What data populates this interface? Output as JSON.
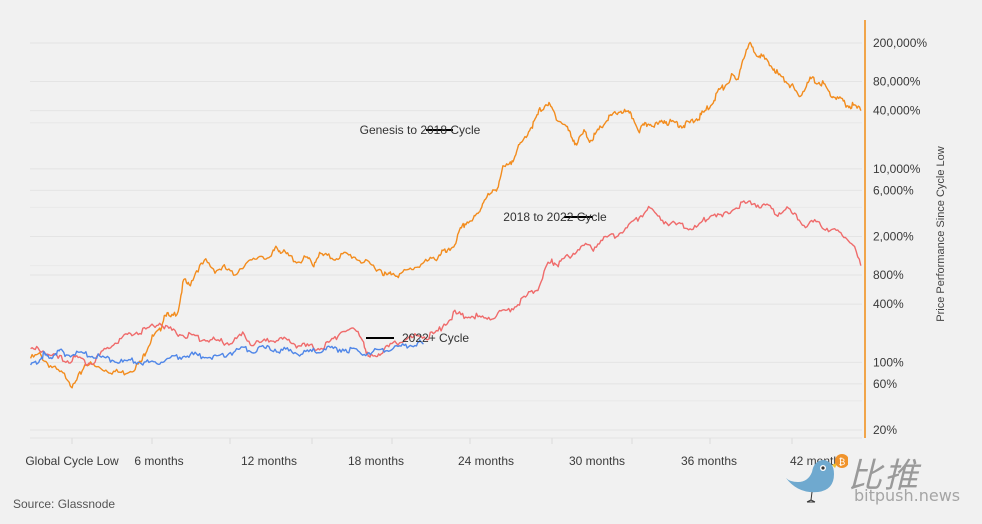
{
  "chart_data": {
    "type": "line",
    "title": "",
    "xlabel": "",
    "ylabel": "Price Performance Since Cycle Low",
    "y_scale": "log",
    "ylim": [
      15,
      300000
    ],
    "xlim_months": [
      -1,
      44
    ],
    "grid": true,
    "x_ticks": [
      {
        "m": -1.2,
        "label": "Global Cycle Low"
      },
      {
        "m": 6,
        "label": "6 months"
      },
      {
        "m": 12,
        "label": "12 months"
      },
      {
        "m": 18,
        "label": "18 months"
      },
      {
        "m": 24,
        "label": "24 months"
      },
      {
        "m": 30,
        "label": "30 months"
      },
      {
        "m": 36,
        "label": "36 months"
      },
      {
        "m": 42,
        "label": "42 months"
      }
    ],
    "y_ticks": [
      {
        "v": 200000,
        "label": "200,000%"
      },
      {
        "v": 80000,
        "label": "80,000%"
      },
      {
        "v": 40000,
        "label": "40,000%"
      },
      {
        "v": 10000,
        "label": "10,000%"
      },
      {
        "v": 6000,
        "label": "6,000%"
      },
      {
        "v": 2000,
        "label": "2,000%"
      },
      {
        "v": 800,
        "label": "800%"
      },
      {
        "v": 400,
        "label": "400%"
      },
      {
        "v": 100,
        "label": "100%"
      },
      {
        "v": 60,
        "label": "60%"
      },
      {
        "v": 20,
        "label": "20%"
      }
    ],
    "series": [
      {
        "name": "Genesis to 2018 Cycle",
        "color": "#f28c1e",
        "points": [
          [
            -1,
            110
          ],
          [
            -0.5,
            120
          ],
          [
            0,
            95
          ],
          [
            0.5,
            80
          ],
          [
            1,
            70
          ],
          [
            1.3,
            55
          ],
          [
            1.6,
            70
          ],
          [
            2,
            100
          ],
          [
            2.5,
            90
          ],
          [
            3,
            85
          ],
          [
            3.5,
            80
          ],
          [
            4,
            78
          ],
          [
            4.5,
            85
          ],
          [
            5,
            100
          ],
          [
            5.3,
            140
          ],
          [
            5.6,
            180
          ],
          [
            6,
            210
          ],
          [
            6.3,
            330
          ],
          [
            6.6,
            280
          ],
          [
            7,
            350
          ],
          [
            7.3,
            700
          ],
          [
            7.6,
            620
          ],
          [
            8,
            900
          ],
          [
            8.5,
            1100
          ],
          [
            9,
            900
          ],
          [
            9.5,
            950
          ],
          [
            10,
            800
          ],
          [
            10.5,
            1000
          ],
          [
            11,
            1100
          ],
          [
            11.5,
            1300
          ],
          [
            12,
            1150
          ],
          [
            12.3,
            1600
          ],
          [
            12.6,
            1400
          ],
          [
            13,
            1250
          ],
          [
            13.5,
            1100
          ],
          [
            14,
            1200
          ],
          [
            14.3,
            1000
          ],
          [
            14.6,
            1300
          ],
          [
            15,
            1250
          ],
          [
            15.5,
            1200
          ],
          [
            16,
            1300
          ],
          [
            16.5,
            1250
          ],
          [
            17,
            1100
          ],
          [
            17.5,
            1000
          ],
          [
            18,
            900
          ],
          [
            18.3,
            780
          ],
          [
            18.6,
            850
          ],
          [
            19,
            800
          ],
          [
            19.5,
            900
          ],
          [
            20,
            1000
          ],
          [
            20.5,
            1100
          ],
          [
            21,
            1200
          ],
          [
            21.3,
            1400
          ],
          [
            21.6,
            1350
          ],
          [
            22,
            1700
          ],
          [
            22.3,
            2300
          ],
          [
            22.6,
            2800
          ],
          [
            23,
            3000
          ],
          [
            23.3,
            3500
          ],
          [
            23.6,
            5000
          ],
          [
            24,
            5500
          ],
          [
            24.3,
            6500
          ],
          [
            24.6,
            10000
          ],
          [
            25,
            11000
          ],
          [
            25.3,
            15000
          ],
          [
            25.6,
            18000
          ],
          [
            26,
            25000
          ],
          [
            26.3,
            30000
          ],
          [
            26.6,
            40000
          ],
          [
            27,
            48000
          ],
          [
            27.3,
            40000
          ],
          [
            27.6,
            32000
          ],
          [
            28,
            28000
          ],
          [
            28.3,
            22000
          ],
          [
            28.6,
            18000
          ],
          [
            29,
            24000
          ],
          [
            29.3,
            20000
          ],
          [
            29.6,
            22000
          ],
          [
            30,
            28000
          ],
          [
            30.3,
            33000
          ],
          [
            30.6,
            36000
          ],
          [
            31,
            40000
          ],
          [
            31.3,
            38000
          ],
          [
            31.6,
            35000
          ],
          [
            32,
            25000
          ],
          [
            32.3,
            28000
          ],
          [
            32.6,
            30000
          ],
          [
            33,
            28000
          ],
          [
            33.3,
            32000
          ],
          [
            33.6,
            30000
          ],
          [
            34,
            30000
          ],
          [
            34.3,
            28000
          ],
          [
            34.6,
            29000
          ],
          [
            35,
            32000
          ],
          [
            35.3,
            35000
          ],
          [
            35.6,
            40000
          ],
          [
            36,
            50000
          ],
          [
            36.3,
            65000
          ],
          [
            36.6,
            70000
          ],
          [
            37,
            90000
          ],
          [
            37.3,
            80000
          ],
          [
            37.6,
            140000
          ],
          [
            38,
            190000
          ],
          [
            38.3,
            160000
          ],
          [
            38.6,
            150000
          ],
          [
            39,
            120000
          ],
          [
            39.3,
            110000
          ],
          [
            39.6,
            90000
          ],
          [
            40,
            80000
          ],
          [
            40.3,
            70000
          ],
          [
            40.6,
            55000
          ],
          [
            41,
            70000
          ],
          [
            41.3,
            85000
          ],
          [
            41.6,
            80000
          ],
          [
            42,
            75000
          ],
          [
            42.3,
            60000
          ],
          [
            42.6,
            55000
          ],
          [
            43,
            50000
          ],
          [
            43.3,
            45000
          ],
          [
            43.6,
            45000
          ],
          [
            44,
            40000
          ]
        ]
      },
      {
        "name": "2018 to 2022 Cycle",
        "color": "#ef6b6b",
        "points": [
          [
            -1,
            130
          ],
          [
            -0.5,
            140
          ],
          [
            0,
            120
          ],
          [
            0.5,
            110
          ],
          [
            1,
            105
          ],
          [
            1.5,
            110
          ],
          [
            2,
            100
          ],
          [
            2.5,
            105
          ],
          [
            3,
            130
          ],
          [
            3.5,
            160
          ],
          [
            4,
            180
          ],
          [
            4.5,
            200
          ],
          [
            5,
            210
          ],
          [
            5.5,
            230
          ],
          [
            6,
            260
          ],
          [
            6.5,
            220
          ],
          [
            7,
            200
          ],
          [
            7.5,
            190
          ],
          [
            8,
            180
          ],
          [
            8.5,
            175
          ],
          [
            9,
            170
          ],
          [
            9.5,
            160
          ],
          [
            10,
            165
          ],
          [
            10.5,
            190
          ],
          [
            11,
            155
          ],
          [
            11.5,
            160
          ],
          [
            12,
            170
          ],
          [
            12.5,
            175
          ],
          [
            13,
            165
          ],
          [
            13.5,
            150
          ],
          [
            14,
            145
          ],
          [
            14.5,
            140
          ],
          [
            15,
            150
          ],
          [
            15.5,
            180
          ],
          [
            16,
            220
          ],
          [
            16.5,
            210
          ],
          [
            17,
            180
          ],
          [
            17.3,
            110
          ],
          [
            17.6,
            115
          ],
          [
            18,
            130
          ],
          [
            18.5,
            145
          ],
          [
            19,
            165
          ],
          [
            19.5,
            175
          ],
          [
            20,
            190
          ],
          [
            20.5,
            185
          ],
          [
            21,
            200
          ],
          [
            21.5,
            260
          ],
          [
            22,
            320
          ],
          [
            22.5,
            300
          ],
          [
            23,
            310
          ],
          [
            23.5,
            280
          ],
          [
            24,
            300
          ],
          [
            24.5,
            330
          ],
          [
            25,
            350
          ],
          [
            25.5,
            420
          ],
          [
            26,
            500
          ],
          [
            26.5,
            600
          ],
          [
            27,
            1000
          ],
          [
            27.3,
            1100
          ],
          [
            27.6,
            1000
          ],
          [
            28,
            1200
          ],
          [
            28.5,
            1400
          ],
          [
            29,
            1600
          ],
          [
            29.5,
            1500
          ],
          [
            30,
            1900
          ],
          [
            30.5,
            2000
          ],
          [
            31,
            2200
          ],
          [
            31.5,
            2600
          ],
          [
            32,
            3200
          ],
          [
            32.5,
            4000
          ],
          [
            33,
            3200
          ],
          [
            33.5,
            2800
          ],
          [
            34,
            2600
          ],
          [
            34.5,
            2500
          ],
          [
            35,
            2400
          ],
          [
            35.5,
            3000
          ],
          [
            36,
            3500
          ],
          [
            36.5,
            3200
          ],
          [
            37,
            3800
          ],
          [
            37.5,
            4200
          ],
          [
            38,
            4600
          ],
          [
            38.5,
            4200
          ],
          [
            39,
            4000
          ],
          [
            39.5,
            3500
          ],
          [
            40,
            3800
          ],
          [
            40.5,
            3200
          ],
          [
            41,
            2600
          ],
          [
            41.5,
            2800
          ],
          [
            42,
            2500
          ],
          [
            42.5,
            2300
          ],
          [
            43,
            2100
          ],
          [
            43.5,
            1800
          ],
          [
            44,
            1000
          ]
        ]
      },
      {
        "name": "2022+ Cycle",
        "color": "#4f86e8",
        "points": [
          [
            -1,
            90
          ],
          [
            -0.6,
            105
          ],
          [
            -0.3,
            120
          ],
          [
            0,
            110
          ],
          [
            0.3,
            125
          ],
          [
            0.6,
            130
          ],
          [
            1,
            120
          ],
          [
            1.5,
            125
          ],
          [
            2,
            120
          ],
          [
            2.5,
            115
          ],
          [
            3,
            110
          ],
          [
            3.5,
            105
          ],
          [
            4,
            100
          ],
          [
            4.5,
            105
          ],
          [
            5,
            100
          ],
          [
            5.5,
            98
          ],
          [
            6,
            100
          ],
          [
            6.5,
            110
          ],
          [
            7,
            115
          ],
          [
            7.5,
            120
          ],
          [
            8,
            118
          ],
          [
            8.5,
            115
          ],
          [
            9,
            110
          ],
          [
            9.5,
            120
          ],
          [
            10,
            130
          ],
          [
            10.5,
            140
          ],
          [
            11,
            135
          ],
          [
            11.5,
            138
          ],
          [
            12,
            140
          ],
          [
            12.5,
            135
          ],
          [
            13,
            130
          ],
          [
            13.5,
            125
          ],
          [
            14,
            128
          ],
          [
            14.5,
            130
          ],
          [
            15,
            140
          ],
          [
            15.5,
            135
          ],
          [
            16,
            138
          ],
          [
            16.5,
            130
          ],
          [
            17,
            125
          ],
          [
            17.5,
            128
          ],
          [
            18,
            135
          ],
          [
            18.5,
            140
          ],
          [
            19,
            145
          ],
          [
            19.5,
            150
          ],
          [
            20,
            160
          ],
          [
            20.3,
            155
          ]
        ]
      }
    ],
    "annotations": [
      {
        "text": "Genesis to 2018 Cycle",
        "series": 0
      },
      {
        "text": "2018 to 2022 Cycle",
        "series": 1
      },
      {
        "text": "2022+ Cycle",
        "series": 2
      }
    ]
  },
  "source": "Source: Glassnode",
  "watermark": {
    "cn": "比推",
    "en": "bitpush.news"
  }
}
